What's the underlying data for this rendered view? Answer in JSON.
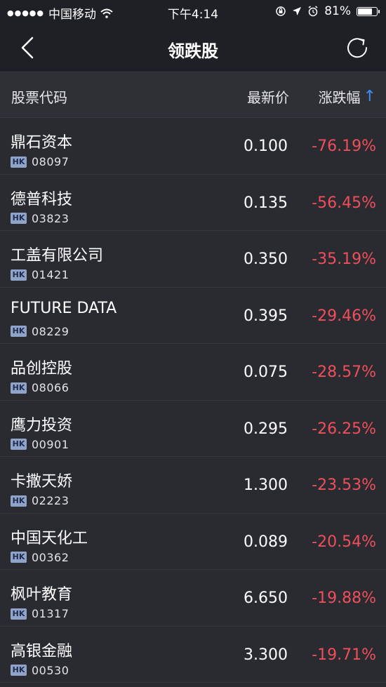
{
  "status": {
    "carrier": "中国移动",
    "time": "下午4:14",
    "battery": "81%",
    "battery_level": 0.81
  },
  "nav": {
    "title": "领跌股"
  },
  "columns": {
    "name": "股票代码",
    "price": "最新价",
    "change": "涨跌幅",
    "sort_arrow": "↑"
  },
  "colors": {
    "background": "#2a2b31",
    "negative": "#ee4f5b",
    "sort_accent": "#3d8ff5",
    "badge": "#8fa4c8"
  },
  "stocks": [
    {
      "name": "鼎石资本",
      "market": "HK",
      "code": "08097",
      "price": "0.100",
      "change": "-76.19%"
    },
    {
      "name": "德普科技",
      "market": "HK",
      "code": "03823",
      "price": "0.135",
      "change": "-56.45%"
    },
    {
      "name": "工盖有限公司",
      "market": "HK",
      "code": "01421",
      "price": "0.350",
      "change": "-35.19%"
    },
    {
      "name": "FUTURE DATA",
      "market": "HK",
      "code": "08229",
      "price": "0.395",
      "change": "-29.46%"
    },
    {
      "name": "品创控股",
      "market": "HK",
      "code": "08066",
      "price": "0.075",
      "change": "-28.57%"
    },
    {
      "name": "鹰力投资",
      "market": "HK",
      "code": "00901",
      "price": "0.295",
      "change": "-26.25%"
    },
    {
      "name": "卡撒天娇",
      "market": "HK",
      "code": "02223",
      "price": "1.300",
      "change": "-23.53%"
    },
    {
      "name": "中国天化工",
      "market": "HK",
      "code": "00362",
      "price": "0.089",
      "change": "-20.54%"
    },
    {
      "name": "枫叶教育",
      "market": "HK",
      "code": "01317",
      "price": "6.650",
      "change": "-19.88%"
    },
    {
      "name": "高银金融",
      "market": "HK",
      "code": "00530",
      "price": "3.300",
      "change": "-19.71%"
    }
  ]
}
